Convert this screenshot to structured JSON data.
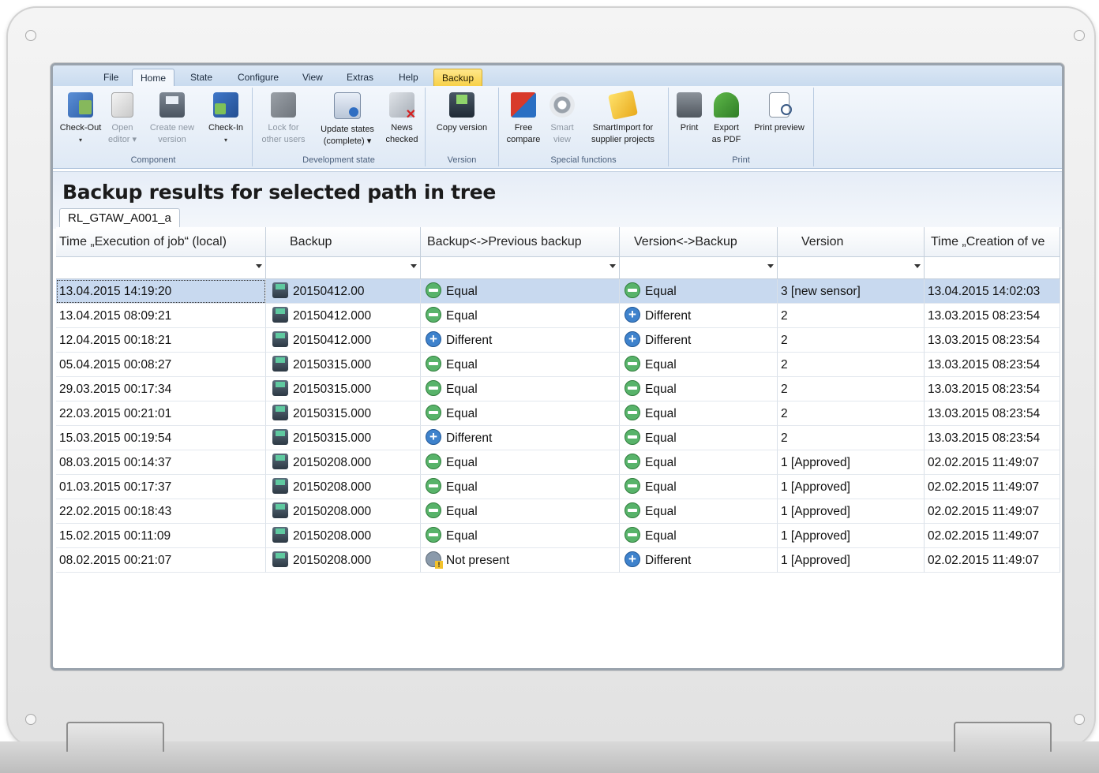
{
  "ribbon": {
    "tabs": [
      "File",
      "Home",
      "State",
      "Configure",
      "View",
      "Extras",
      "Help",
      "Backup"
    ],
    "groups": {
      "component": {
        "label": "Component",
        "checkout": [
          "Check-Out",
          "▾"
        ],
        "open_editor": [
          "Open",
          "editor ▾"
        ],
        "create_version": [
          "Create new",
          "version"
        ],
        "checkin": [
          "Check-In",
          "▾"
        ]
      },
      "development": {
        "label": "Development state",
        "lock": [
          "Lock for",
          "other users"
        ],
        "update": [
          "Update states",
          "(complete) ▾"
        ],
        "news": [
          "News",
          "checked"
        ]
      },
      "version": {
        "label": "Version",
        "copy": [
          "Copy version"
        ]
      },
      "special": {
        "label": "Special functions",
        "free_compare": [
          "Free",
          "compare"
        ],
        "smart_view": [
          "Smart",
          "view"
        ],
        "smart_import": [
          "SmartImport for",
          "supplier projects"
        ]
      },
      "print": {
        "label": "Print",
        "print": [
          "Print"
        ],
        "export_pdf": [
          "Export",
          "as PDF"
        ],
        "print_preview": [
          "Print preview"
        ]
      }
    }
  },
  "page": {
    "title": "Backup results for selected path in tree",
    "doc_tab": "RL_GTAW_A001_a"
  },
  "grid": {
    "columns": [
      "Time „Execution of job“ (local)",
      "Backup",
      "Backup<->Previous backup",
      "Version<->Backup",
      "Version",
      "Time „Creation of ve"
    ],
    "rows": [
      [
        "13.04.2015 14:19:20",
        "20150412.00",
        "Equal",
        "Equal",
        "3 [new sensor]",
        "13.04.2015 14:02:03"
      ],
      [
        "13.04.2015 08:09:21",
        "20150412.000",
        "Equal",
        "Different",
        "2",
        "13.03.2015 08:23:54"
      ],
      [
        "12.04.2015 00:18:21",
        "20150412.000",
        "Different",
        "Different",
        "2",
        "13.03.2015 08:23:54"
      ],
      [
        "05.04.2015 00:08:27",
        "20150315.000",
        "Equal",
        "Equal",
        "2",
        "13.03.2015 08:23:54"
      ],
      [
        "29.03.2015 00:17:34",
        "20150315.000",
        "Equal",
        "Equal",
        "2",
        "13.03.2015 08:23:54"
      ],
      [
        "22.03.2015 00:21:01",
        "20150315.000",
        "Equal",
        "Equal",
        "2",
        "13.03.2015 08:23:54"
      ],
      [
        "15.03.2015 00:19:54",
        "20150315.000",
        "Different",
        "Equal",
        "2",
        "13.03.2015 08:23:54"
      ],
      [
        "08.03.2015 00:14:37",
        "20150208.000",
        "Equal",
        "Equal",
        "1 [Approved]",
        "02.02.2015 11:49:07"
      ],
      [
        "01.03.2015 00:17:37",
        "20150208.000",
        "Equal",
        "Equal",
        "1 [Approved]",
        "02.02.2015 11:49:07"
      ],
      [
        "22.02.2015 00:18:43",
        "20150208.000",
        "Equal",
        "Equal",
        "1 [Approved]",
        "02.02.2015 11:49:07"
      ],
      [
        "15.02.2015 00:11:09",
        "20150208.000",
        "Equal",
        "Equal",
        "1 [Approved]",
        "02.02.2015 11:49:07"
      ],
      [
        "08.02.2015 00:21:07",
        "20150208.000",
        "Not present",
        "Different",
        "1 [Approved]",
        "02.02.2015 11:49:07"
      ]
    ]
  }
}
